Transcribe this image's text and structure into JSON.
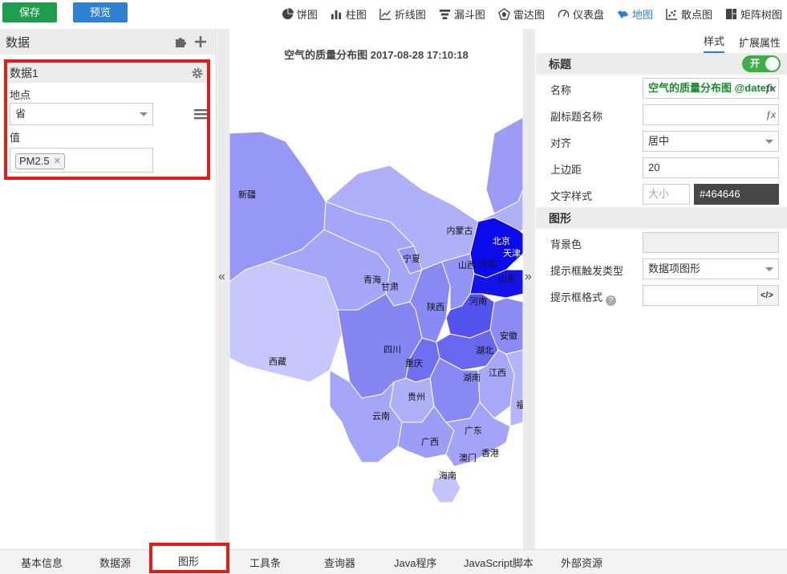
{
  "toolbar": {
    "save_label": "保存",
    "preview_label": "预览",
    "chart_types": [
      {
        "label": "饼图",
        "icon": "pie-chart-icon"
      },
      {
        "label": "柱图",
        "icon": "bar-chart-icon"
      },
      {
        "label": "折线图",
        "icon": "line-chart-icon"
      },
      {
        "label": "漏斗图",
        "icon": "funnel-chart-icon"
      },
      {
        "label": "雷达图",
        "icon": "radar-chart-icon"
      },
      {
        "label": "仪表盘",
        "icon": "gauge-chart-icon"
      },
      {
        "label": "地图",
        "icon": "map-chart-icon",
        "active": true
      },
      {
        "label": "散点图",
        "icon": "scatter-chart-icon"
      },
      {
        "label": "矩阵树图",
        "icon": "treemap-chart-icon"
      }
    ]
  },
  "left": {
    "header": "数据",
    "dataset_name": "数据1",
    "location_label": "地点",
    "location_value": "省",
    "value_label": "值",
    "value_tag": "PM2.5"
  },
  "chart": {
    "title": "空气的质量分布图 2017-08-28 17:10:18",
    "regions": [
      "新疆",
      "西藏",
      "青海",
      "甘肃",
      "宁夏",
      "内蒙古",
      "北京",
      "天津",
      "河北",
      "山西",
      "山东",
      "陕西",
      "河南",
      "四川",
      "重庆",
      "湖北",
      "安徽",
      "湖南",
      "江西",
      "贵州",
      "云南",
      "广西",
      "广东",
      "香港",
      "澳门",
      "海南",
      "福"
    ],
    "colors": {
      "high": "#0a0aeb",
      "mid": "#7d7df5",
      "low": "#c4c4fb"
    }
  },
  "right": {
    "tabs": [
      "样式",
      "扩展属性"
    ],
    "title_section": "标题",
    "toggle_label": "开",
    "name_label": "名称",
    "name_value": "空气的质量分布图 @dateti",
    "subtitle_label": "副标题名称",
    "align_label": "对齐",
    "align_value": "居中",
    "margin_label": "上边距",
    "margin_value": "20",
    "textstyle_label": "文字样式",
    "size_placeholder": "大小",
    "color_value": "#464646",
    "graphic_section": "图形",
    "bg_label": "背景色",
    "tooltip_trigger_label": "提示框触发类型",
    "tooltip_trigger_value": "数据项图形",
    "tooltip_format_label": "提示框格式",
    "code_button": "</>"
  },
  "bottom_tabs": [
    "基本信息",
    "数据源",
    "图形",
    "工具条",
    "查询器",
    "Java程序",
    "JavaScript脚本",
    "外部资源"
  ],
  "active_bottom_tab": "图形",
  "accent": {
    "save": "#1d9e4f",
    "primary": "#2f80d1",
    "highlight": "#e21b1b",
    "toggle": "#3fae49"
  }
}
